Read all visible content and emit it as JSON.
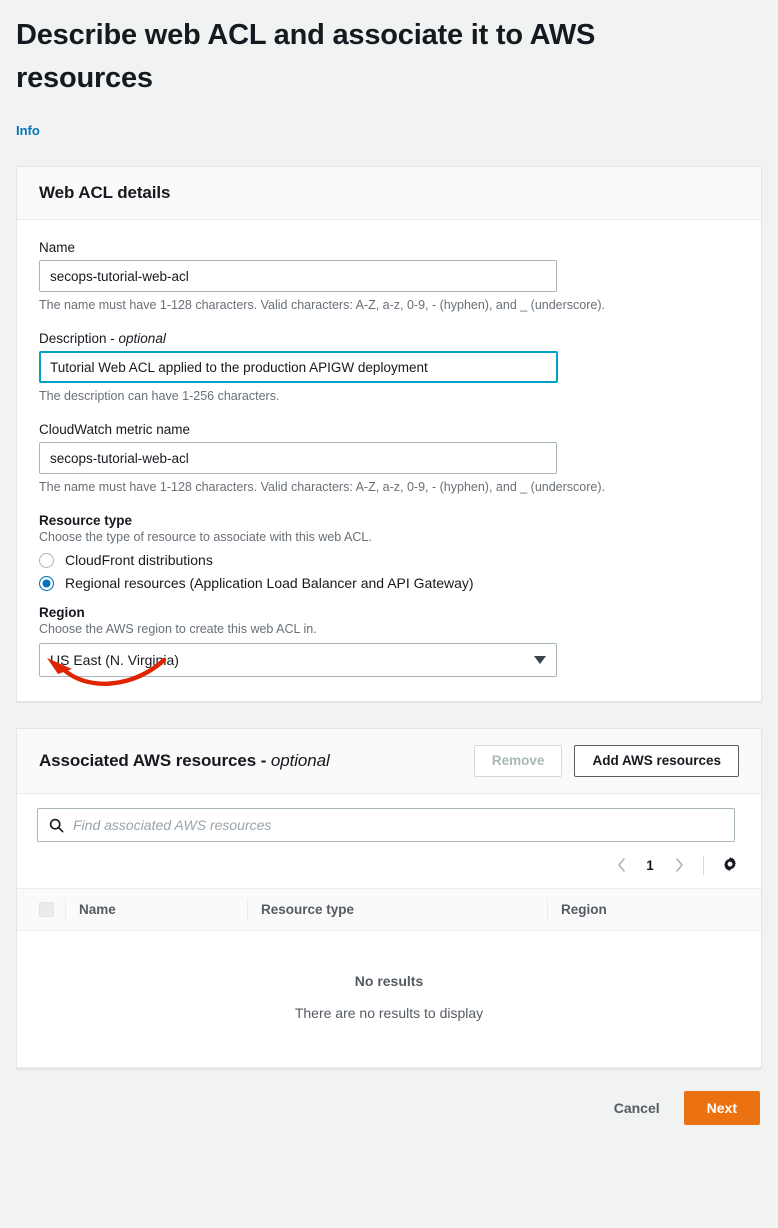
{
  "page": {
    "title": "Describe web ACL and associate it to AWS resources",
    "info_link": "Info"
  },
  "web_acl_details": {
    "card_title": "Web ACL details",
    "name": {
      "label": "Name",
      "value": "secops-tutorial-web-acl",
      "hint": "The name must have 1-128 characters. Valid characters: A-Z, a-z, 0-9, - (hyphen), and _ (underscore)."
    },
    "description": {
      "label": "Description - ",
      "label_optional": "optional",
      "value": "Tutorial Web ACL applied to the production APIGW deployment",
      "hint": "The description can have 1-256 characters."
    },
    "cloudwatch_metric_name": {
      "label": "CloudWatch metric name",
      "value": "secops-tutorial-web-acl",
      "hint": "The name must have 1-128 characters. Valid characters: A-Z, a-z, 0-9, - (hyphen), and _ (underscore)."
    },
    "resource_type": {
      "label": "Resource type",
      "description": "Choose the type of resource to associate with this web ACL.",
      "options": [
        {
          "label": "CloudFront distributions",
          "selected": false
        },
        {
          "label": "Regional resources (Application Load Balancer and API Gateway)",
          "selected": true
        }
      ]
    },
    "region": {
      "label": "Region",
      "description": "Choose the AWS region to create this web ACL in.",
      "selected": "US East (N. Virginia)"
    }
  },
  "associated_resources": {
    "card_title": "Associated AWS resources - ",
    "card_title_optional": "optional",
    "remove_button": "Remove",
    "add_button": "Add AWS resources",
    "search_placeholder": "Find associated AWS resources",
    "pagination": {
      "prev_icon": "chevron-left-icon",
      "page": "1",
      "next_icon": "chevron-right-icon",
      "settings_icon": "gear-icon"
    },
    "columns": [
      "Name",
      "Resource type",
      "Region"
    ],
    "rows": [],
    "empty_title": "No results",
    "empty_subtitle": "There are no results to display"
  },
  "footer": {
    "cancel": "Cancel",
    "next": "Next"
  },
  "colors": {
    "page_background": "#f1f3f3",
    "accent_link": "#0073bb",
    "primary_button": "#ec7211",
    "focus_border": "#00a1c9",
    "annotation_arrow": "#e02400"
  }
}
